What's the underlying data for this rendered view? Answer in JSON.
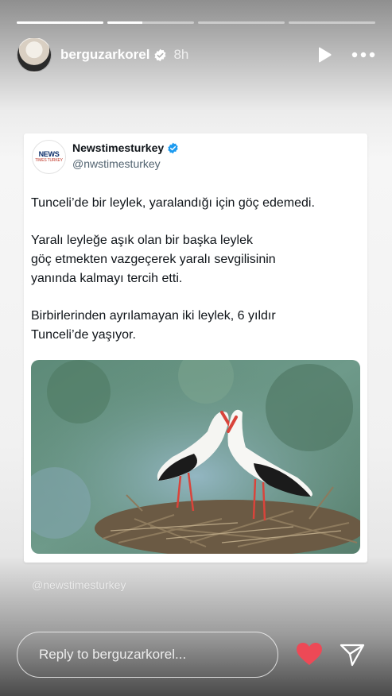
{
  "story": {
    "progress": [
      1,
      0.4,
      0,
      0
    ],
    "username": "berguzarkorel",
    "time": "8h"
  },
  "tweet": {
    "avatar_text": [
      "NEWS",
      "TIMES TURKEY"
    ],
    "name": "Newstimesturkey",
    "handle": "@nwstimesturkey",
    "paragraphs": [
      "Tunceli’de bir leylek, yaralandığı için göç edemedi.",
      "Yaralı leyleğe aşık olan bir başka leylek\ngöç etmekten vazgeçerek yaralı sevgilisinin\nyanında kalmayı tercih etti.",
      "Birbirlerinden ayrılamayan iki leylek, 6 yıldır\nTunceli’de yaşıyor."
    ],
    "verified_color": "#1d9bf0"
  },
  "watermark": "@newstimesturkey",
  "reply": {
    "placeholder": "Reply to berguzarkorel..."
  },
  "colors": {
    "heart": "#ed4956"
  },
  "icons": [
    "verified-icon",
    "play-icon",
    "more-icon",
    "heart-icon",
    "send-icon"
  ]
}
